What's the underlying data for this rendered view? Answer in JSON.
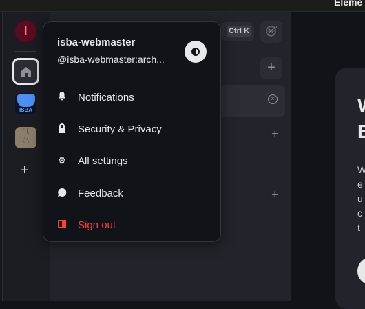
{
  "window": {
    "title": "Eleme"
  },
  "space_bar": {
    "avatar_initial": "I",
    "spaces": [
      {
        "name": "Home",
        "icon": "home-icon"
      },
      {
        "name": "ISBA",
        "label": "ISBA"
      },
      {
        "name": "runes-space"
      }
    ],
    "add_label": "+"
  },
  "room_list": {
    "search_shortcut": "Ctrl K",
    "explore_icon": "compass-icon",
    "add_label": "+",
    "close_icon": "×"
  },
  "main": {
    "title_partial": "W\nE",
    "body_partial": "W\ne\nu\nc\nt"
  },
  "user_menu": {
    "display_name": "isba-webmaster",
    "user_id": "@isba-webmaster:arch...",
    "theme_toggle_icon": "contrast-icon",
    "items": [
      {
        "label": "Notifications",
        "icon": "bell-icon"
      },
      {
        "label": "Security & Privacy",
        "icon": "lock-icon"
      },
      {
        "label": "All settings",
        "icon": "gear-icon"
      },
      {
        "label": "Feedback",
        "icon": "chat-bubble-icon"
      },
      {
        "label": "Sign out",
        "icon": "sign-out-icon",
        "color": "#ff3d3d"
      }
    ]
  }
}
